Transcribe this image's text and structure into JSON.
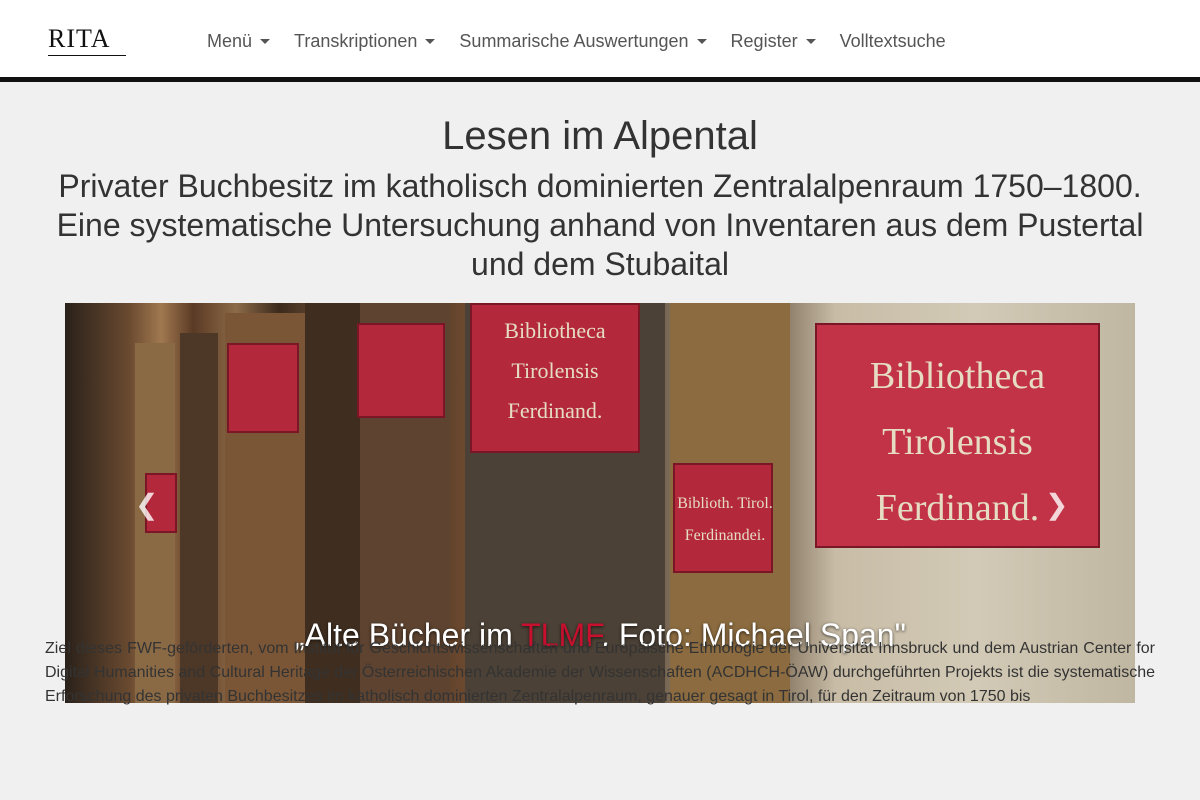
{
  "brand": {
    "logo_text": "RITA"
  },
  "nav": {
    "items": [
      {
        "label": "Menü",
        "has_dropdown": true
      },
      {
        "label": "Transkriptionen",
        "has_dropdown": true
      },
      {
        "label": "Summarische Auswertungen",
        "has_dropdown": true
      },
      {
        "label": "Register",
        "has_dropdown": true
      },
      {
        "label": "Volltextsuche",
        "has_dropdown": false
      }
    ]
  },
  "page": {
    "title": "Lesen im Alpental",
    "subtitle": "Privater Buchbesitz im katholisch dominierten Zentralalpenraum 1750–1800. Eine systematische Untersuchung anhand von Inventaren aus dem Pustertal und dem Stubaital"
  },
  "carousel": {
    "caption_before": "„Alte Bücher im ",
    "caption_highlight": "TLMF",
    "caption_after": ". Foto: Michael Span\"",
    "prev_icon": "chevron-left-icon",
    "next_icon": "chevron-right-icon",
    "book_labels": {
      "big": [
        "Bibliotheca",
        "Tirolensis",
        "Ferdinand."
      ],
      "middle": [
        "Bibliotheca",
        "Tirolensis",
        "Ferdinand."
      ],
      "small": [
        "Biblioth. Tirol.",
        "Ferdinandei."
      ]
    }
  },
  "intro_text": "Ziel dieses FWF-geförderten, vom Institut für Geschichtswissenschaften und Europäische Ethnologie der Universität Innsbruck und dem Austrian Center for Digital Humanities and Cultural Heritage der Österreichischen Akademie der Wissenschaften (ACDHCH-ÖAW) durchgeführten Projekts ist die systematische Erforschung des privaten Buchbesitzes im katholisch dominierten Zentralalpenraum, genauer gesagt in Tirol, für den Zeitraum von 1750 bis",
  "colors": {
    "highlight": "#c8102e",
    "navbar_border": "#111111",
    "background": "#f0f0f0"
  }
}
